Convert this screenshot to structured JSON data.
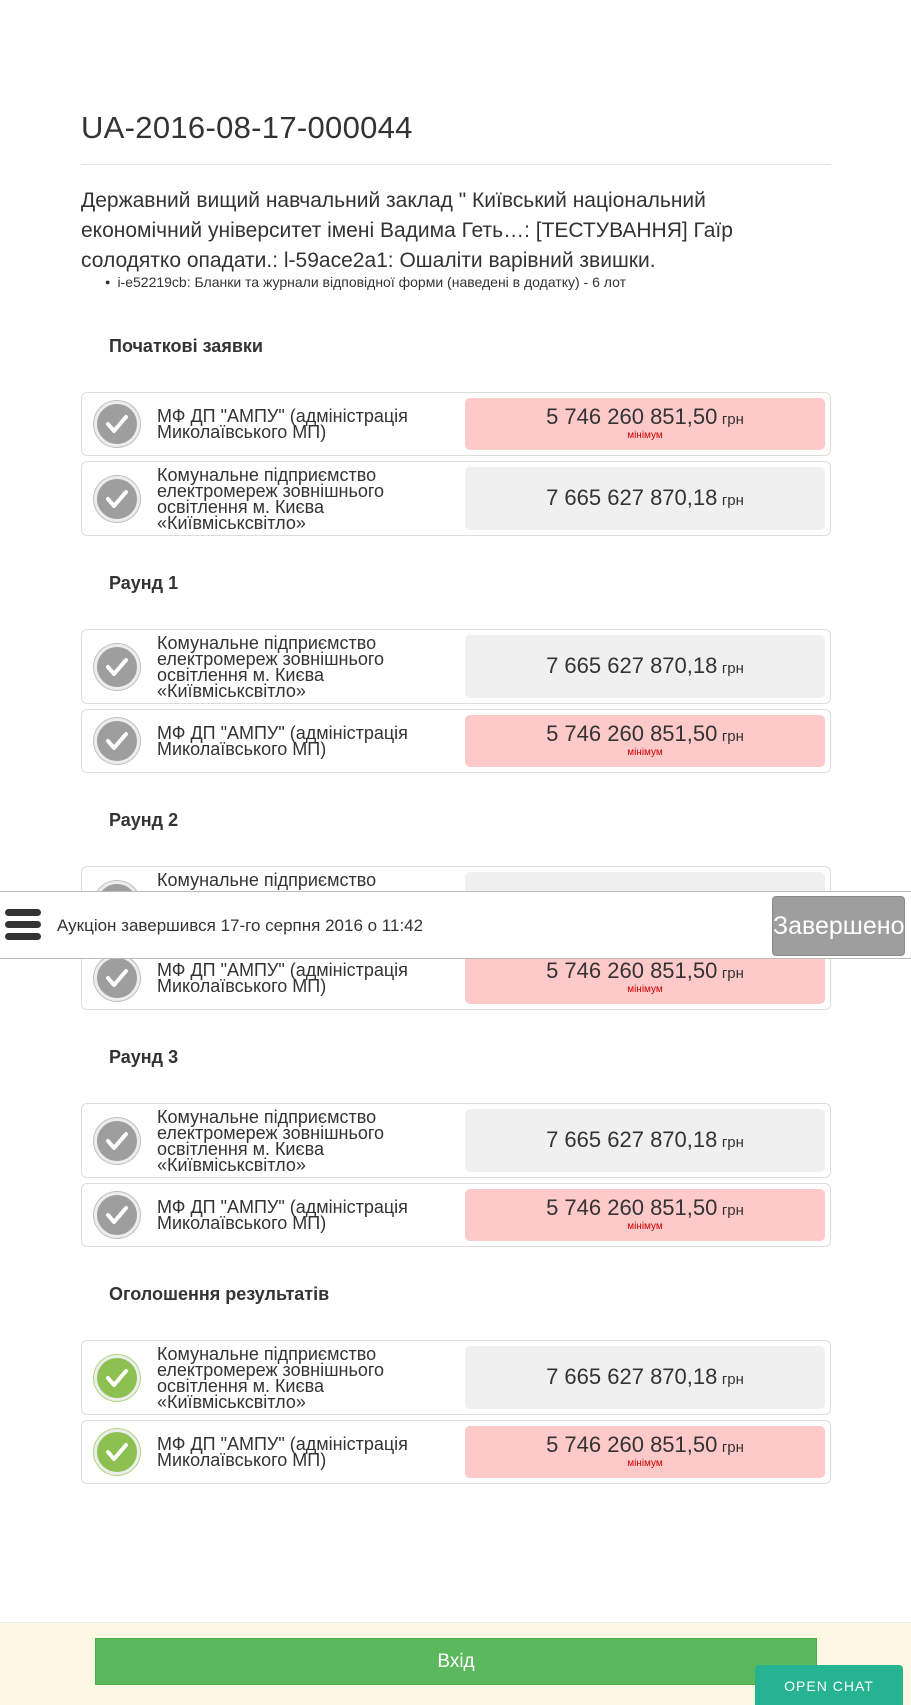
{
  "auction": {
    "id": "UA-2016-08-17-000044",
    "title": "Державний вищий навчальний заклад \" Київський національний економічний університет імені Вадима Геть…: [ТЕСТУВАННЯ] Гаїр солодятко опадати.: l-59ace2a1: Ошаліти варівний звишки.",
    "lot": "i-e52219cb: Бланки та журнали відповідної форми (наведені в додатку) - 6 лот"
  },
  "labels": {
    "currency": "грн",
    "minimum": "мінімум"
  },
  "sections": [
    {
      "title": "Початкові заявки",
      "bids": [
        {
          "name": "МФ ДП \"АМПУ\" (адміністрація Миколаївського МП)",
          "amount": "5 746 260 851,50",
          "minimum": true,
          "winner": false
        },
        {
          "name": "Комунальне підприємство електромереж зовнішнього освітлення м. Києва «Київміськсвітло»",
          "amount": "7 665 627 870,18",
          "minimum": false,
          "winner": false
        }
      ]
    },
    {
      "title": "Раунд 1",
      "bids": [
        {
          "name": "Комунальне підприємство електромереж зовнішнього освітлення м. Києва «Київміськсвітло»",
          "amount": "7 665 627 870,18",
          "minimum": false,
          "winner": false
        },
        {
          "name": "МФ ДП \"АМПУ\" (адміністрація Миколаївського МП)",
          "amount": "5 746 260 851,50",
          "minimum": true,
          "winner": false
        }
      ]
    },
    {
      "title": "Раунд 2",
      "bids": [
        {
          "name": "Комунальне підприємство",
          "amount": "",
          "minimum": false,
          "winner": false
        },
        {
          "name": "МФ ДП \"АМПУ\" (адміністрація Миколаївського МП)",
          "amount": "5 746 260 851,50",
          "minimum": true,
          "winner": false
        }
      ]
    },
    {
      "title": "Раунд 3",
      "bids": [
        {
          "name": "Комунальне підприємство електромереж зовнішнього освітлення м. Києва «Київміськсвітло»",
          "amount": "7 665 627 870,18",
          "minimum": false,
          "winner": false
        },
        {
          "name": "МФ ДП \"АМПУ\" (адміністрація Миколаївського МП)",
          "amount": "5 746 260 851,50",
          "minimum": true,
          "winner": false
        }
      ]
    },
    {
      "title": "Оголошення результатів",
      "bids": [
        {
          "name": "Комунальне підприємство електромереж зовнішнього освітлення м. Києва «Київміськсвітло»",
          "amount": "7 665 627 870,18",
          "minimum": false,
          "winner": true
        },
        {
          "name": "МФ ДП \"АМПУ\" (адміністрація Миколаївського МП)",
          "amount": "5 746 260 851,50",
          "minimum": true,
          "winner": true
        }
      ]
    }
  ],
  "status_bar": {
    "menu_icon": "hamburger-menu-icon",
    "text": "Аукціон завершився 17-го серпня 2016 о 11:42",
    "status_label": "Завершено"
  },
  "footer": {
    "login_label": "Вхід",
    "chat_label": "OPEN CHAT"
  },
  "colors": {
    "minimum_bg": "#fec9c9",
    "normal_bg": "#f0f0f0",
    "winner_check": "#8cc152",
    "check": "#9e9e9e",
    "login": "#5cb85c",
    "chat": "#26b391"
  }
}
